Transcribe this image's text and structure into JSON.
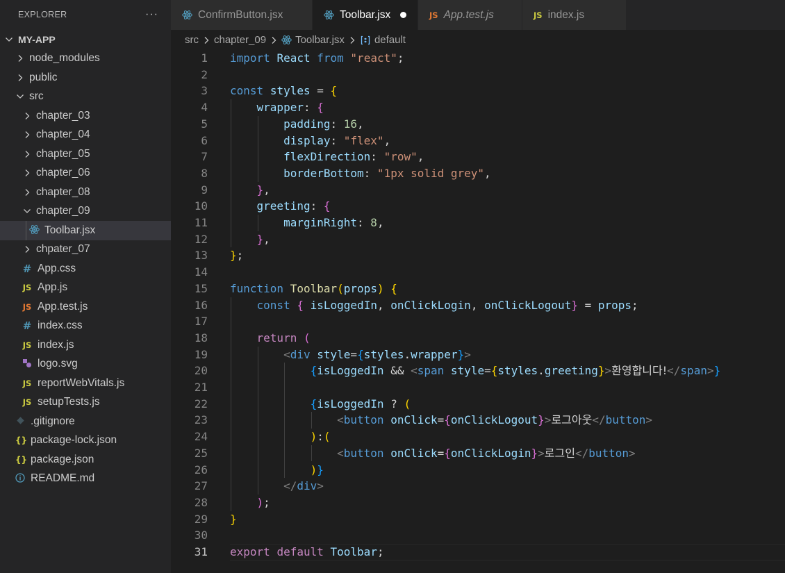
{
  "explorer": {
    "title": "EXPLORER",
    "more": "···",
    "tree": [
      {
        "label": "MY-APP",
        "kind": "root",
        "indent": 0,
        "chevron": "down"
      },
      {
        "label": "node_modules",
        "kind": "folder",
        "indent": 1,
        "chevron": "right"
      },
      {
        "label": "public",
        "kind": "folder",
        "indent": 1,
        "chevron": "right"
      },
      {
        "label": "src",
        "kind": "folder",
        "indent": 1,
        "chevron": "down"
      },
      {
        "label": "chapter_03",
        "kind": "folder",
        "indent": 2,
        "chevron": "right"
      },
      {
        "label": "chapter_04",
        "kind": "folder",
        "indent": 2,
        "chevron": "right"
      },
      {
        "label": "chapter_05",
        "kind": "folder",
        "indent": 2,
        "chevron": "right"
      },
      {
        "label": "chapter_06",
        "kind": "folder",
        "indent": 2,
        "chevron": "right"
      },
      {
        "label": "chapter_08",
        "kind": "folder",
        "indent": 2,
        "chevron": "right"
      },
      {
        "label": "chapter_09",
        "kind": "folder",
        "indent": 2,
        "chevron": "down"
      },
      {
        "label": "Toolbar.jsx",
        "kind": "file",
        "icon": "react-icon",
        "indent": 3,
        "selected": true
      },
      {
        "label": "chpater_07",
        "kind": "folder",
        "indent": 2,
        "chevron": "right"
      },
      {
        "label": "App.css",
        "kind": "file",
        "icon": "css-icon",
        "indent": 2
      },
      {
        "label": "App.js",
        "kind": "file",
        "icon": "js-icon",
        "indent": 2
      },
      {
        "label": "App.test.js",
        "kind": "file",
        "icon": "test-icon",
        "indent": 2
      },
      {
        "label": "index.css",
        "kind": "file",
        "icon": "css-icon",
        "indent": 2
      },
      {
        "label": "index.js",
        "kind": "file",
        "icon": "js-icon",
        "indent": 2
      },
      {
        "label": "logo.svg",
        "kind": "file",
        "icon": "svg-icon",
        "indent": 2
      },
      {
        "label": "reportWebVitals.js",
        "kind": "file",
        "icon": "js-icon",
        "indent": 2
      },
      {
        "label": "setupTests.js",
        "kind": "file",
        "icon": "js-icon",
        "indent": 2
      },
      {
        "label": ".gitignore",
        "kind": "file",
        "icon": "git-icon",
        "indent": 1
      },
      {
        "label": "package-lock.json",
        "kind": "file",
        "icon": "json-icon",
        "indent": 1
      },
      {
        "label": "package.json",
        "kind": "file",
        "icon": "json-icon",
        "indent": 1
      },
      {
        "label": "README.md",
        "kind": "file",
        "icon": "info-icon",
        "indent": 1
      }
    ]
  },
  "tabs": [
    {
      "label": "ConfirmButton.jsx",
      "icon": "react-icon",
      "active": false,
      "italic": false,
      "dirty": false
    },
    {
      "label": "Toolbar.jsx",
      "icon": "react-icon",
      "active": true,
      "italic": false,
      "dirty": true
    },
    {
      "label": "App.test.js",
      "icon": "test-icon",
      "active": false,
      "italic": true,
      "dirty": false
    },
    {
      "label": "index.js",
      "icon": "js-icon",
      "active": false,
      "italic": false,
      "dirty": false
    }
  ],
  "breadcrumb": {
    "items": [
      "src",
      "chapter_09",
      "Toolbar.jsx",
      "default"
    ]
  },
  "editor": {
    "current_line": 31,
    "lines": [
      [
        [
          "kw",
          "import"
        ],
        [
          "txt",
          " "
        ],
        [
          "var",
          "React"
        ],
        [
          "txt",
          " "
        ],
        [
          "kw",
          "from"
        ],
        [
          "txt",
          " "
        ],
        [
          "str",
          "\"react\""
        ],
        [
          "txt",
          ";"
        ]
      ],
      [],
      [
        [
          "kw",
          "const"
        ],
        [
          "txt",
          " "
        ],
        [
          "var",
          "styles"
        ],
        [
          "txt",
          " = "
        ],
        [
          "b1",
          "{"
        ]
      ],
      [
        [
          "txt",
          "    "
        ],
        [
          "var",
          "wrapper"
        ],
        [
          "txt",
          ": "
        ],
        [
          "b2",
          "{"
        ]
      ],
      [
        [
          "txt",
          "        "
        ],
        [
          "var",
          "padding"
        ],
        [
          "txt",
          ": "
        ],
        [
          "num",
          "16"
        ],
        [
          "txt",
          ","
        ]
      ],
      [
        [
          "txt",
          "        "
        ],
        [
          "var",
          "display"
        ],
        [
          "txt",
          ": "
        ],
        [
          "str",
          "\"flex\""
        ],
        [
          "txt",
          ","
        ]
      ],
      [
        [
          "txt",
          "        "
        ],
        [
          "var",
          "flexDirection"
        ],
        [
          "txt",
          ": "
        ],
        [
          "str",
          "\"row\""
        ],
        [
          "txt",
          ","
        ]
      ],
      [
        [
          "txt",
          "        "
        ],
        [
          "var",
          "borderBottom"
        ],
        [
          "txt",
          ": "
        ],
        [
          "str",
          "\"1px solid grey\""
        ],
        [
          "txt",
          ","
        ]
      ],
      [
        [
          "txt",
          "    "
        ],
        [
          "b2",
          "}"
        ],
        [
          "txt",
          ","
        ]
      ],
      [
        [
          "txt",
          "    "
        ],
        [
          "var",
          "greeting"
        ],
        [
          "txt",
          ": "
        ],
        [
          "b2",
          "{"
        ]
      ],
      [
        [
          "txt",
          "        "
        ],
        [
          "var",
          "marginRight"
        ],
        [
          "txt",
          ": "
        ],
        [
          "num",
          "8"
        ],
        [
          "txt",
          ","
        ]
      ],
      [
        [
          "txt",
          "    "
        ],
        [
          "b2",
          "}"
        ],
        [
          "txt",
          ","
        ]
      ],
      [
        [
          "b1",
          "}"
        ],
        [
          "txt",
          ";"
        ]
      ],
      [],
      [
        [
          "kw",
          "function"
        ],
        [
          "txt",
          " "
        ],
        [
          "fn",
          "Toolbar"
        ],
        [
          "b1",
          "("
        ],
        [
          "var",
          "props"
        ],
        [
          "b1",
          ")"
        ],
        [
          "txt",
          " "
        ],
        [
          "b1",
          "{"
        ]
      ],
      [
        [
          "txt",
          "    "
        ],
        [
          "kw",
          "const"
        ],
        [
          "txt",
          " "
        ],
        [
          "b2",
          "{"
        ],
        [
          "txt",
          " "
        ],
        [
          "var",
          "isLoggedIn"
        ],
        [
          "txt",
          ", "
        ],
        [
          "var",
          "onClickLogin"
        ],
        [
          "txt",
          ", "
        ],
        [
          "var",
          "onClickLogout"
        ],
        [
          "b2",
          "}"
        ],
        [
          "txt",
          " = "
        ],
        [
          "var",
          "props"
        ],
        [
          "txt",
          ";"
        ]
      ],
      [],
      [
        [
          "txt",
          "    "
        ],
        [
          "ctl",
          "return"
        ],
        [
          "txt",
          " "
        ],
        [
          "b2",
          "("
        ]
      ],
      [
        [
          "txt",
          "        "
        ],
        [
          "tagb",
          "<"
        ],
        [
          "tag",
          "div"
        ],
        [
          "txt",
          " "
        ],
        [
          "var",
          "style"
        ],
        [
          "txt",
          "="
        ],
        [
          "b3",
          "{"
        ],
        [
          "var",
          "styles"
        ],
        [
          "txt",
          "."
        ],
        [
          "var",
          "wrapper"
        ],
        [
          "b3",
          "}"
        ],
        [
          "tagb",
          ">"
        ]
      ],
      [
        [
          "txt",
          "            "
        ],
        [
          "b3",
          "{"
        ],
        [
          "var",
          "isLoggedIn"
        ],
        [
          "txt",
          " && "
        ],
        [
          "tagb",
          "<"
        ],
        [
          "tag",
          "span"
        ],
        [
          "txt",
          " "
        ],
        [
          "var",
          "style"
        ],
        [
          "txt",
          "="
        ],
        [
          "b1",
          "{"
        ],
        [
          "var",
          "styles"
        ],
        [
          "txt",
          "."
        ],
        [
          "var",
          "greeting"
        ],
        [
          "b1",
          "}"
        ],
        [
          "tagb",
          ">"
        ],
        [
          "ko",
          "환영합니다!"
        ],
        [
          "tagb",
          "</"
        ],
        [
          "tag",
          "span"
        ],
        [
          "tagb",
          ">"
        ],
        [
          "b3",
          "}"
        ]
      ],
      [],
      [
        [
          "txt",
          "            "
        ],
        [
          "b3",
          "{"
        ],
        [
          "var",
          "isLoggedIn"
        ],
        [
          "txt",
          " ? "
        ],
        [
          "b1",
          "("
        ]
      ],
      [
        [
          "txt",
          "                "
        ],
        [
          "tagb",
          "<"
        ],
        [
          "tag",
          "button"
        ],
        [
          "txt",
          " "
        ],
        [
          "var",
          "onClick"
        ],
        [
          "txt",
          "="
        ],
        [
          "b2",
          "{"
        ],
        [
          "var",
          "onClickLogout"
        ],
        [
          "b2",
          "}"
        ],
        [
          "tagb",
          ">"
        ],
        [
          "ko",
          "로그아웃"
        ],
        [
          "tagb",
          "</"
        ],
        [
          "tag",
          "button"
        ],
        [
          "tagb",
          ">"
        ]
      ],
      [
        [
          "txt",
          "            "
        ],
        [
          "b1",
          ")"
        ],
        [
          "txt",
          ":"
        ],
        [
          "b1",
          "("
        ]
      ],
      [
        [
          "txt",
          "                "
        ],
        [
          "tagb",
          "<"
        ],
        [
          "tag",
          "button"
        ],
        [
          "txt",
          " "
        ],
        [
          "var",
          "onClick"
        ],
        [
          "txt",
          "="
        ],
        [
          "b2",
          "{"
        ],
        [
          "var",
          "onClickLogin"
        ],
        [
          "b2",
          "}"
        ],
        [
          "tagb",
          ">"
        ],
        [
          "ko",
          "로그인"
        ],
        [
          "tagb",
          "</"
        ],
        [
          "tag",
          "button"
        ],
        [
          "tagb",
          ">"
        ]
      ],
      [
        [
          "txt",
          "            "
        ],
        [
          "b1",
          ")"
        ],
        [
          "b3",
          "}"
        ]
      ],
      [
        [
          "txt",
          "        "
        ],
        [
          "tagb",
          "</"
        ],
        [
          "tag",
          "div"
        ],
        [
          "tagb",
          ">"
        ]
      ],
      [
        [
          "txt",
          "    "
        ],
        [
          "b2",
          ")"
        ],
        [
          "txt",
          ";"
        ]
      ],
      [
        [
          "b1",
          "}"
        ]
      ],
      [],
      [
        [
          "ctl",
          "export"
        ],
        [
          "txt",
          " "
        ],
        [
          "ctl",
          "default"
        ],
        [
          "txt",
          " "
        ],
        [
          "var",
          "Toolbar"
        ],
        [
          "txt",
          ";"
        ]
      ]
    ]
  }
}
